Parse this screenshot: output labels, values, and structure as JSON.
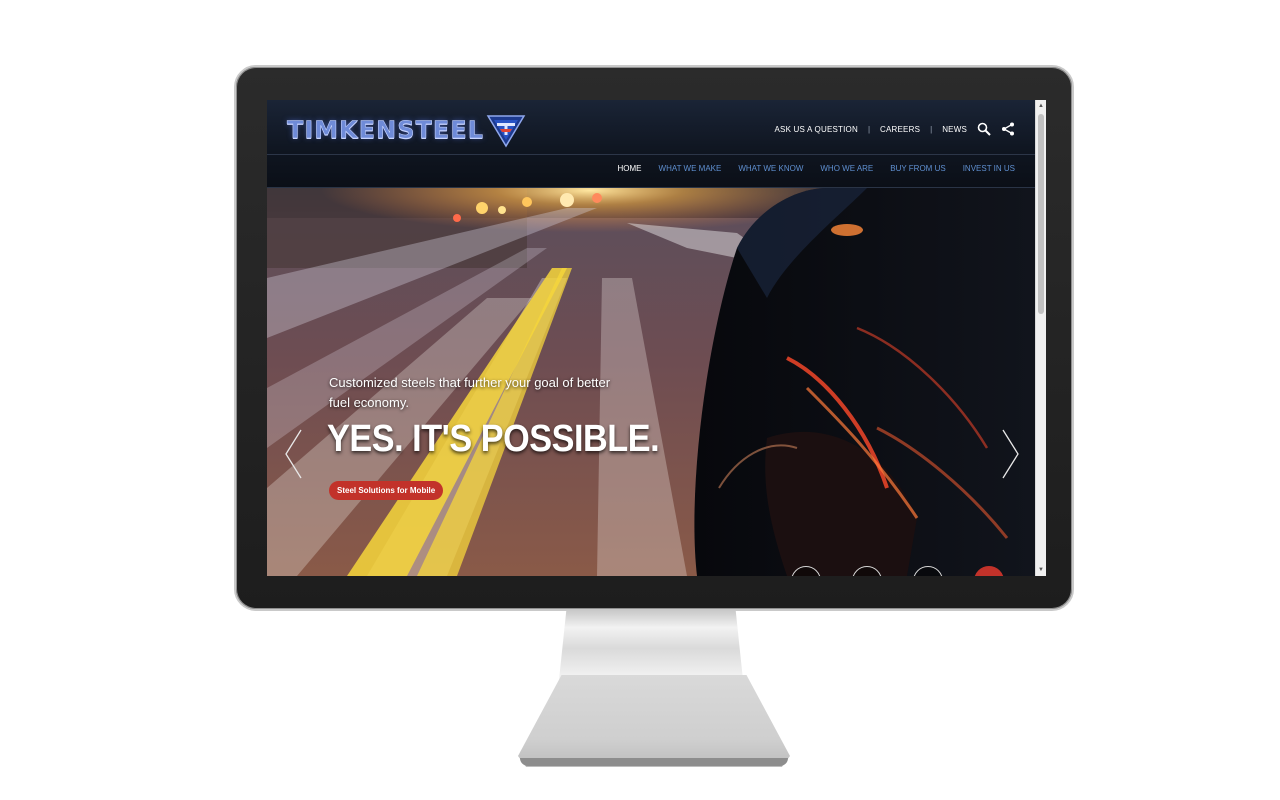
{
  "site": {
    "brand": "TIMKENSTEEL",
    "utility_links": [
      "ASK US A QUESTION",
      "CAREERS",
      "NEWS"
    ],
    "utility_separator": "|",
    "nav": [
      {
        "label": "HOME",
        "active": true
      },
      {
        "label": "WHAT WE MAKE",
        "active": false
      },
      {
        "label": "WHAT WE KNOW",
        "active": false
      },
      {
        "label": "WHO WE ARE",
        "active": false
      },
      {
        "label": "BUY FROM US",
        "active": false
      },
      {
        "label": "INVEST IN US",
        "active": false
      }
    ]
  },
  "hero": {
    "subtitle": "Customized steels that further your goal of better fuel economy.",
    "title": "YES. IT'S POSSIBLE.",
    "cta": "Steel Solutions for Mobile",
    "slide_count": 4,
    "active_slide": 4
  },
  "icons": {
    "search": "search-icon",
    "share": "share-icon",
    "prev": "chevron-left-icon",
    "next": "chevron-right-icon"
  },
  "colors": {
    "brand_blue": "#6f8bd8",
    "nav_blue": "#5f8fd0",
    "cta_red": "#c2322a"
  }
}
